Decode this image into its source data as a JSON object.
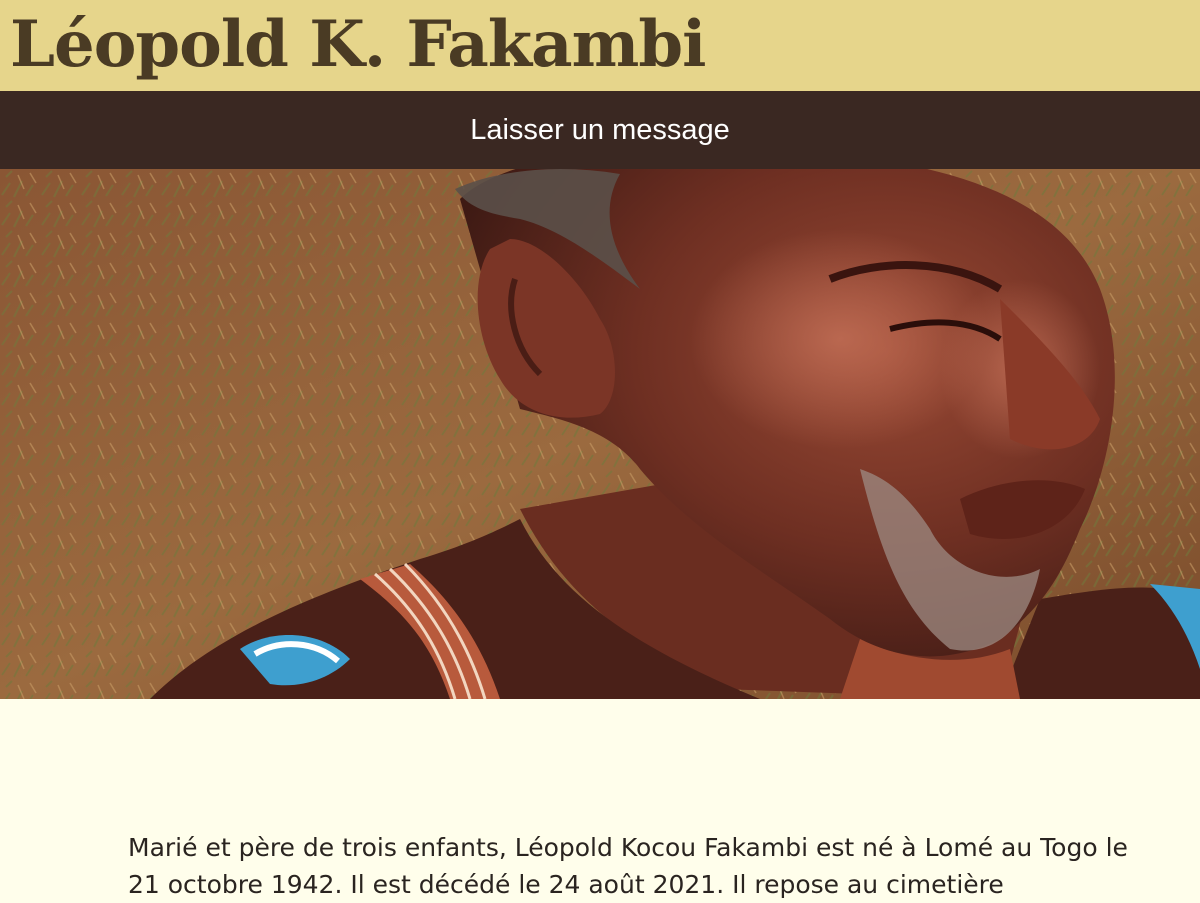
{
  "header": {
    "title": "Léopold K. Fakambi"
  },
  "nav": {
    "message_link": "Laisser un message"
  },
  "hero": {
    "alt": "Portrait photograph"
  },
  "main": {
    "bio": "Marié et père de trois enfants, Léopold Kocou Fakambi est né à Lomé au Togo le 21 octobre 1942. Il est décédé le 24 août 2021. Il repose au cimetière"
  },
  "colors": {
    "header_bg": "#e6d58b",
    "title": "#4a3b24",
    "nav_bg": "#3a2822",
    "page_bg": "#fffeeb"
  }
}
